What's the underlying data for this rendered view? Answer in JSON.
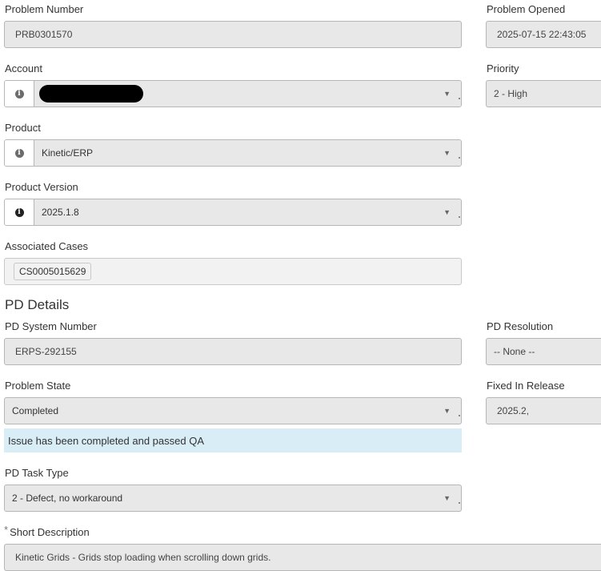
{
  "form": {
    "problem_number": {
      "label": "Problem Number",
      "value": "PRB0301570"
    },
    "problem_opened": {
      "label": "Problem Opened",
      "value": "2025-07-15 22:43:05"
    },
    "account": {
      "label": "Account",
      "value": ""
    },
    "priority": {
      "label": "Priority",
      "value": "2 - High"
    },
    "product": {
      "label": "Product",
      "value": "Kinetic/ERP"
    },
    "product_version": {
      "label": "Product Version",
      "value": "2025.1.8"
    },
    "associated_cases": {
      "label": "Associated Cases",
      "chips": [
        "CS0005015629"
      ]
    }
  },
  "pd_details": {
    "heading": "PD Details",
    "system_number": {
      "label": "PD System Number",
      "value": "ERPS-292155"
    },
    "resolution": {
      "label": "PD Resolution",
      "value": "-- None --"
    },
    "problem_state": {
      "label": "Problem State",
      "value": "Completed"
    },
    "fixed_in_release": {
      "label": "Fixed In Release",
      "value": "2025.2,"
    },
    "state_message": "Issue has been completed and passed QA",
    "task_type": {
      "label": "PD Task Type",
      "value": "2 - Defect, no workaround"
    },
    "short_description": {
      "required_mark": "*",
      "label": "Short Description",
      "value": "Kinetic Grids  - Grids stop loading when scrolling down grids."
    }
  },
  "icons": {
    "info": "info-icon",
    "dropdown": "chevron-down-icon"
  }
}
